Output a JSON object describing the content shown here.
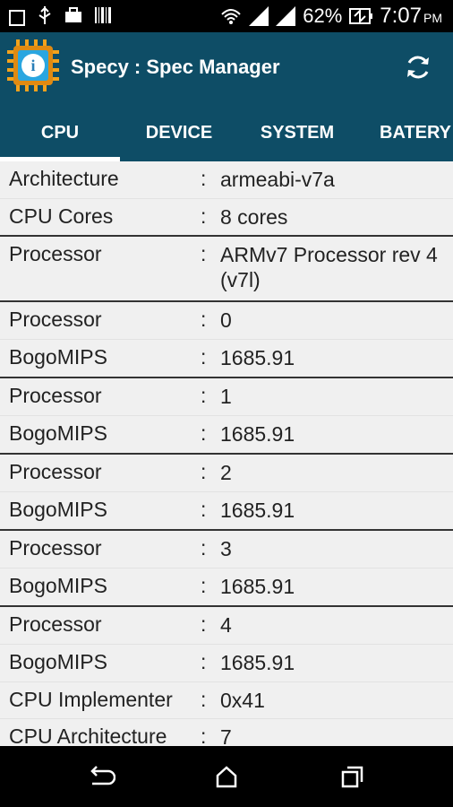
{
  "status_bar": {
    "battery_percent": "62%",
    "time": "7:07",
    "ampm": "PM",
    "icons": [
      "image-icon",
      "usb-icon",
      "briefcase-icon",
      "barcode-icon",
      "wifi-icon",
      "signal-icon",
      "signal-icon",
      "battery-icon"
    ]
  },
  "app": {
    "title": "Specy : Spec Manager",
    "accent_color": "#0e4d66",
    "refresh_icon": "refresh-icon"
  },
  "tabs": [
    {
      "label": "CPU",
      "selected": true
    },
    {
      "label": "DEVICE",
      "selected": false
    },
    {
      "label": "SYSTEM",
      "selected": false
    },
    {
      "label": "BATERY",
      "selected": false
    }
  ],
  "rows": [
    {
      "label": "Architecture",
      "value": "armeabi-v7a"
    },
    {
      "label": "CPU Cores",
      "value": "8 cores"
    },
    {
      "label": "Processor",
      "value": "ARMv7 Processor rev 4 (v7l)"
    },
    {
      "label": "Processor",
      "value": "0"
    },
    {
      "label": "BogoMIPS",
      "value": "1685.91"
    },
    {
      "label": "Processor",
      "value": "1"
    },
    {
      "label": "BogoMIPS",
      "value": "1685.91"
    },
    {
      "label": "Processor",
      "value": "2"
    },
    {
      "label": "BogoMIPS",
      "value": "1685.91"
    },
    {
      "label": "Processor",
      "value": "3"
    },
    {
      "label": "BogoMIPS",
      "value": "1685.91"
    },
    {
      "label": "Processor",
      "value": "4"
    },
    {
      "label": "BogoMIPS",
      "value": "1685.91"
    },
    {
      "label": "CPU Implementer",
      "value": "0x41"
    },
    {
      "label": "CPU Architecture",
      "value": "7"
    }
  ],
  "separator": ":",
  "nav": [
    "back-icon",
    "home-icon",
    "recents-icon"
  ]
}
